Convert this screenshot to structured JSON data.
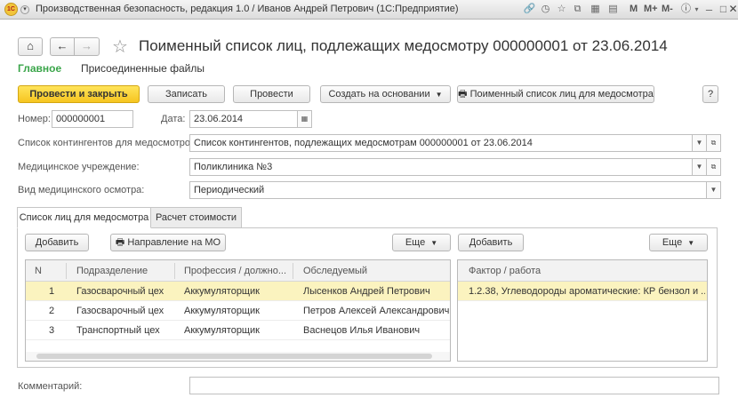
{
  "window": {
    "title": "Производственная безопасность, редакция 1.0 / Иванов Андрей Петрович  (1С:Предприятие)",
    "logo_text": "1С",
    "m_buttons": [
      "M",
      "M+",
      "M-"
    ]
  },
  "header": {
    "title": "Поименный список лиц, подлежащих медосмотру 000000001 от 23.06.2014",
    "home_icon": "home-icon",
    "back_icon": "arrow-left-icon",
    "forward_icon": "arrow-right-icon",
    "star_icon": "star-icon"
  },
  "sections": {
    "main": "Главное",
    "files": "Присоединенные файлы"
  },
  "toolbar": {
    "post_close": "Провести и закрыть",
    "save": "Записать",
    "post": "Провести",
    "create_based_on": "Создать на основании",
    "print_list": "Поименный список лиц для медосмотра",
    "help": "?"
  },
  "form": {
    "number_label": "Номер:",
    "number_value": "000000001",
    "date_label": "Дата:",
    "date_value": "23.06.2014",
    "contingents_label": "Список контингентов для медосмотров:",
    "contingents_value": "Список контингентов, подлежащих медосмотрам 000000001 от 23.06.2014",
    "institution_label": "Медицинское учреждение:",
    "institution_value": "Поликлиника №3",
    "exam_type_label": "Вид медицинского осмотра:",
    "exam_type_value": "Периодический",
    "comment_label": "Комментарий:",
    "comment_value": ""
  },
  "tabs": [
    {
      "label": "Список лиц для медосмотра",
      "active": true
    },
    {
      "label": "Расчет стоимости",
      "active": false
    }
  ],
  "people_panel": {
    "add": "Добавить",
    "direction": "Направление на МО",
    "more": "Еще",
    "columns": [
      "N",
      "Подразделение",
      "Профессия / должно...",
      "Обследуемый"
    ],
    "rows": [
      {
        "n": "1",
        "department": "Газосварочный цех",
        "profession": "Аккумуляторщик",
        "person": "Лысенков Андрей Петрович",
        "selected": true
      },
      {
        "n": "2",
        "department": "Газосварочный цех",
        "profession": "Аккумуляторщик",
        "person": "Петров Алексей Александрович",
        "selected": false
      },
      {
        "n": "3",
        "department": "Транспортный цех",
        "profession": "Аккумуляторщик",
        "person": "Васнецов Илья Иванович",
        "selected": false
      }
    ]
  },
  "factors_panel": {
    "add": "Добавить",
    "more": "Еще",
    "columns": [
      "Фактор / работа"
    ],
    "rows": [
      {
        "factor": "1.2.38, Углеводороды ароматические: КР бензол   и ...",
        "selected": true
      }
    ]
  }
}
